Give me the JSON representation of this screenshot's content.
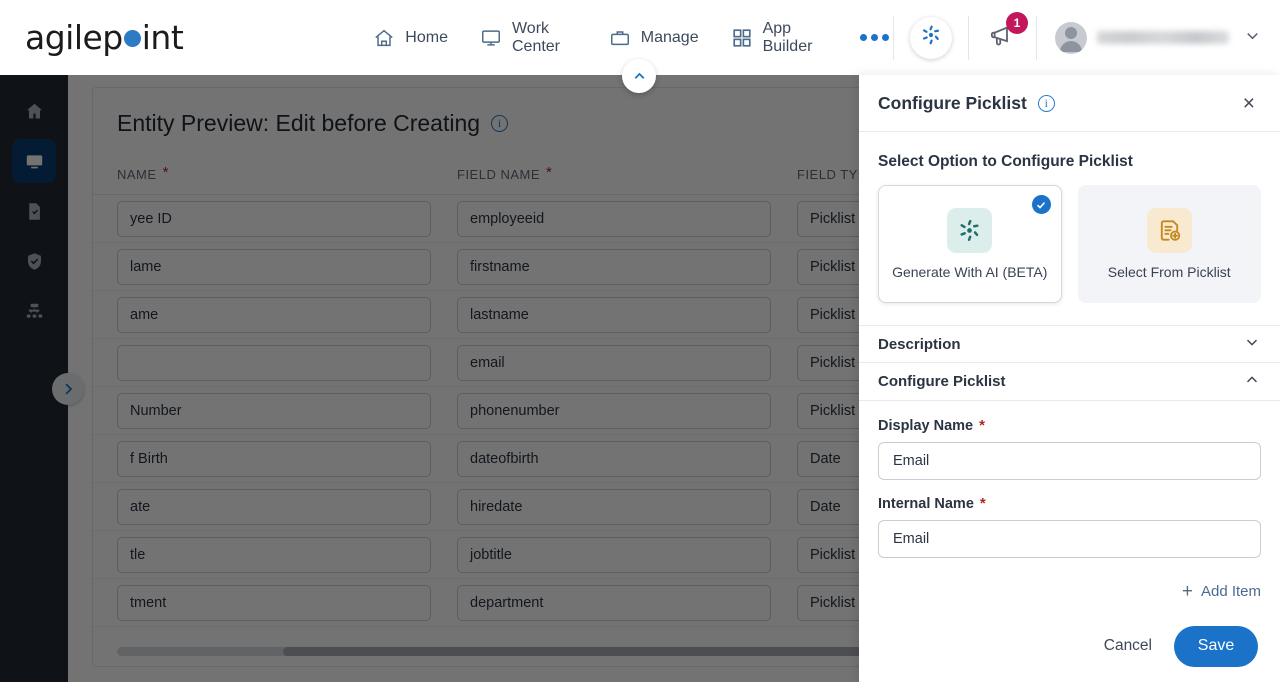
{
  "header": {
    "brand": {
      "pre": "agilep",
      "post": "int",
      "dot_color": "#2b7cc4"
    },
    "nav": [
      {
        "label": "Home",
        "icon": "home-icon"
      },
      {
        "label": "Work Center",
        "icon": "monitor-icon"
      },
      {
        "label": "Manage",
        "icon": "briefcase-icon"
      },
      {
        "label": "App Builder",
        "icon": "grid-icon"
      }
    ],
    "more_label": "",
    "ai_icon": "ai-sparkle-icon",
    "notification_count": "1",
    "user_name": ""
  },
  "rail": {
    "items": [
      {
        "name": "home",
        "icon": "home-icon",
        "active": false
      },
      {
        "name": "work-center",
        "icon": "monitor-icon",
        "active": true
      },
      {
        "name": "documents",
        "icon": "document-check-icon",
        "active": false
      },
      {
        "name": "security",
        "icon": "shield-check-icon",
        "active": false
      },
      {
        "name": "org-chart",
        "icon": "sitemap-icon",
        "active": false
      }
    ]
  },
  "main": {
    "title": "Entity Preview: Edit before Creating",
    "columns": [
      {
        "label": "NAME",
        "required": true
      },
      {
        "label": "FIELD NAME",
        "required": true
      },
      {
        "label": "FIELD TYPE",
        "required": false
      }
    ],
    "rows": [
      {
        "name": "yee ID",
        "field": "employeeid",
        "type": "Picklist"
      },
      {
        "name": "lame",
        "field": "firstname",
        "type": "Picklist"
      },
      {
        "name": "ame",
        "field": "lastname",
        "type": "Picklist"
      },
      {
        "name": "",
        "field": "email",
        "type": "Picklist"
      },
      {
        "name": "Number",
        "field": "phonenumber",
        "type": "Picklist"
      },
      {
        "name": "f Birth",
        "field": "dateofbirth",
        "type": "Date"
      },
      {
        "name": "ate",
        "field": "hiredate",
        "type": "Date"
      },
      {
        "name": "tle",
        "field": "jobtitle",
        "type": "Picklist"
      },
      {
        "name": "tment",
        "field": "department",
        "type": "Picklist"
      }
    ]
  },
  "panel": {
    "title": "Configure Picklist",
    "close_label": "×",
    "select_option_label": "Select Option to Configure Picklist",
    "options": [
      {
        "label": "Generate With AI (BETA)",
        "icon": "ai-sparkle-icon",
        "selected": true
      },
      {
        "label": "Select From Picklist",
        "icon": "document-plus-icon",
        "selected": false
      }
    ],
    "accordions": [
      {
        "label": "Description",
        "expanded": false
      },
      {
        "label": "Configure Picklist",
        "expanded": true
      }
    ],
    "fields": [
      {
        "label": "Display Name",
        "required": true,
        "value": "Email",
        "placeholder": "Display Name"
      },
      {
        "label": "Internal Name",
        "required": true,
        "value": "Email",
        "placeholder": "Internal Name"
      }
    ],
    "add_item_label": "Add Item",
    "cancel_label": "Cancel",
    "save_label": "Save",
    "accent_color": "#1a73c8"
  }
}
